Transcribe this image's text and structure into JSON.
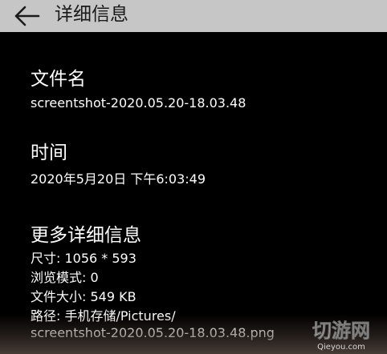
{
  "header": {
    "title": "详细信息",
    "back_icon": "arrow-left-icon"
  },
  "sections": {
    "file_name": {
      "title": "文件名",
      "value": "screentshot-2020.05.20-18.03.48"
    },
    "time": {
      "title": "时间",
      "value": "2020年5月20日 下午6:03:49"
    },
    "more_info": {
      "title": "更多详细信息",
      "items": [
        "尺寸: 1056 * 593",
        "浏览模式: 0",
        "文件大小: 549 KB",
        "路径: 手机存储/Pictures/",
        "screentshot-2020.05.20-18.03.48.png"
      ]
    }
  },
  "watermark": {
    "name": "切游网",
    "url": "Qieyou.com"
  },
  "colors": {
    "header_bg": "#c6c6c6",
    "page_bg": "#000000",
    "text": "#ffffff"
  }
}
